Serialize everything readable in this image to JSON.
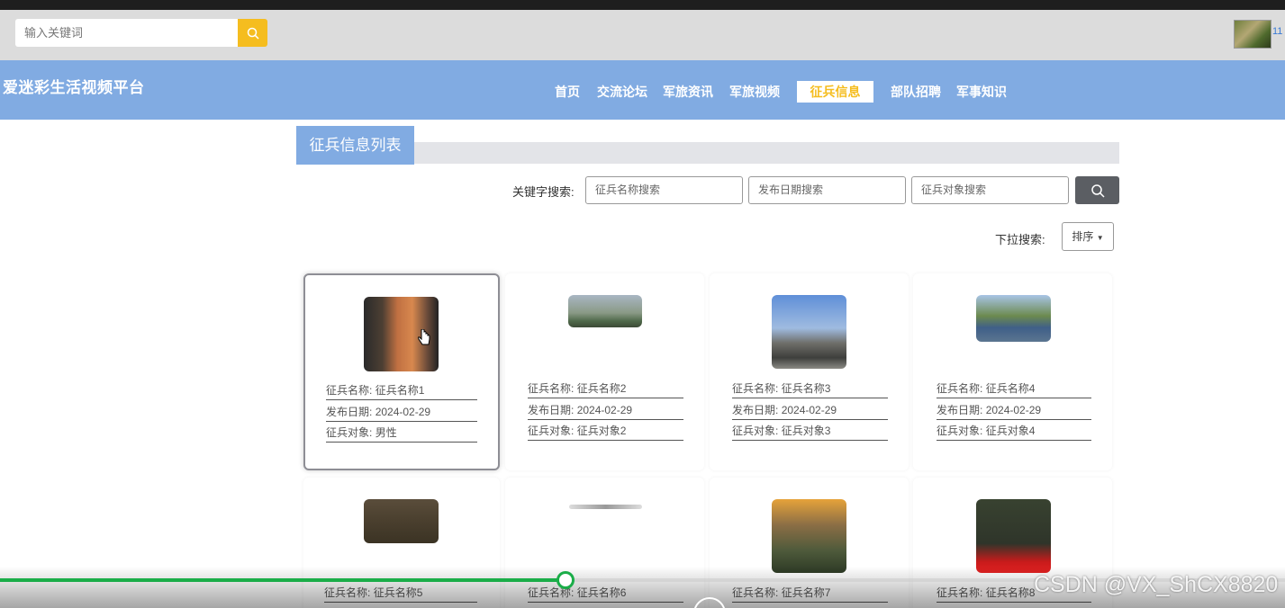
{
  "topbar": {
    "search_placeholder": "输入关键词",
    "avatar_badge": "11"
  },
  "navbar": {
    "logo": "爱迷彩生活视频平台",
    "items": [
      "首页",
      "交流论坛",
      "军旅资讯",
      "军旅视频",
      "征兵信息",
      "部队招聘",
      "军事知识"
    ],
    "active_index": 4
  },
  "page": {
    "title": "征兵信息列表",
    "search_label": "关键字搜索:",
    "fields": [
      "征兵名称搜索",
      "发布日期搜索",
      "征兵对象搜索"
    ],
    "dropdown_label": "下拉搜索:",
    "sort_label": "排序"
  },
  "labels": {
    "name": "征兵名称",
    "date": "发布日期",
    "target": "征兵对象"
  },
  "cards": [
    {
      "name": "征兵名称1",
      "date": "2024-02-29",
      "target": "男性"
    },
    {
      "name": "征兵名称2",
      "date": "2024-02-29",
      "target": "征兵对象2"
    },
    {
      "name": "征兵名称3",
      "date": "2024-02-29",
      "target": "征兵对象3"
    },
    {
      "name": "征兵名称4",
      "date": "2024-02-29",
      "target": "征兵对象4"
    },
    {
      "name": "征兵名称5"
    },
    {
      "name": "征兵名称6"
    },
    {
      "name": "征兵名称7"
    },
    {
      "name": "征兵名称8"
    }
  ],
  "video": {
    "progress": 0.44,
    "watermark": "CSDN @VX_ShCX8820"
  },
  "colors": {
    "nav_bg": "#81abe2",
    "accent": "#f5bd1f",
    "progress": "#1aad48"
  }
}
